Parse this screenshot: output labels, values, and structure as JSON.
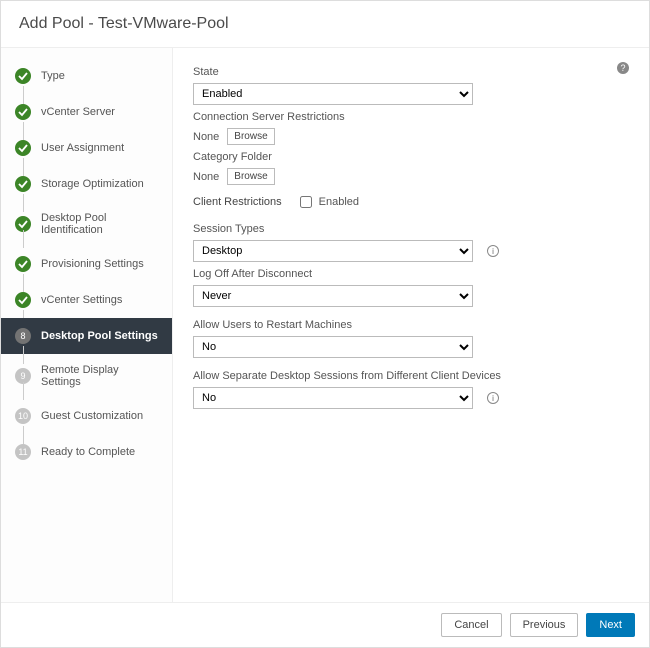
{
  "header": {
    "title": "Add Pool - Test-VMware-Pool"
  },
  "sidebar": {
    "steps": [
      {
        "label": "Type",
        "state": "done"
      },
      {
        "label": "vCenter Server",
        "state": "done"
      },
      {
        "label": "User Assignment",
        "state": "done"
      },
      {
        "label": "Storage Optimization",
        "state": "done"
      },
      {
        "label": "Desktop Pool Identification",
        "state": "done"
      },
      {
        "label": "Provisioning Settings",
        "state": "done"
      },
      {
        "label": "vCenter Settings",
        "state": "done"
      },
      {
        "label": "Desktop Pool Settings",
        "state": "current",
        "num": "8"
      },
      {
        "label": "Remote Display Settings",
        "state": "pending",
        "num": "9"
      },
      {
        "label": "Guest Customization",
        "state": "pending",
        "num": "10"
      },
      {
        "label": "Ready to Complete",
        "state": "pending",
        "num": "11"
      }
    ]
  },
  "form": {
    "state_label": "State",
    "state_value": "Enabled",
    "csr_label": "Connection Server Restrictions",
    "csr_value": "None",
    "browse_label": "Browse",
    "category_label": "Category Folder",
    "category_value": "None",
    "client_restrictions_label": "Client Restrictions",
    "client_enabled_label": "Enabled",
    "session_types_label": "Session Types",
    "session_types_value": "Desktop",
    "logoff_label": "Log Off After Disconnect",
    "logoff_value": "Never",
    "restart_label": "Allow Users to Restart Machines",
    "restart_value": "No",
    "separate_label": "Allow Separate Desktop Sessions from Different Client Devices",
    "separate_value": "No"
  },
  "footer": {
    "cancel": "Cancel",
    "previous": "Previous",
    "next": "Next"
  },
  "glyphs": {
    "help": "?",
    "info": "i"
  }
}
